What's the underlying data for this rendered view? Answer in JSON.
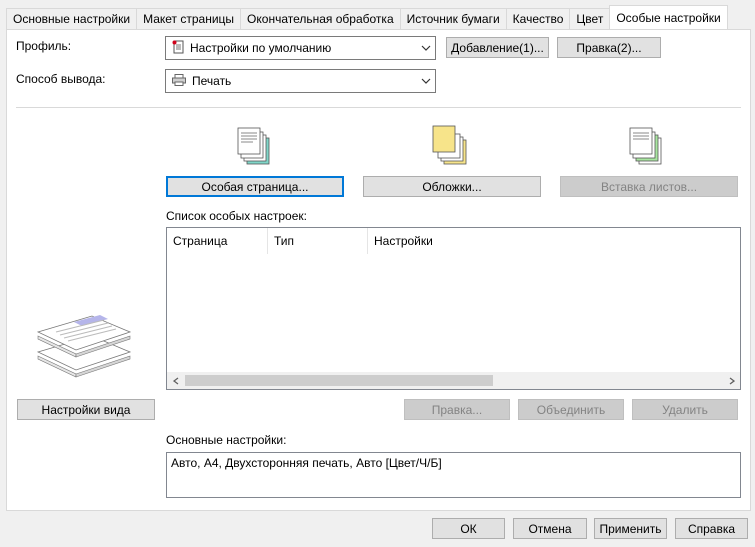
{
  "tabs": [
    {
      "label": "Основные настройки"
    },
    {
      "label": "Макет страницы"
    },
    {
      "label": "Окончательная обработка"
    },
    {
      "label": "Источник бумаги"
    },
    {
      "label": "Качество"
    },
    {
      "label": "Цвет"
    },
    {
      "label": "Особые настройки",
      "active": true
    }
  ],
  "profile": {
    "label": "Профиль:",
    "value": "Настройки по умолчанию",
    "add_button": "Добавление(1)...",
    "edit_button": "Правка(2)..."
  },
  "output": {
    "label": "Способ вывода:",
    "value": "Печать"
  },
  "special_buttons": {
    "special_page": "Особая страница...",
    "covers": "Обложки...",
    "insert_sheets": "Вставка листов..."
  },
  "list": {
    "label": "Список особых настроек:",
    "columns": [
      "Страница",
      "Тип",
      "Настройки"
    ]
  },
  "list_buttons": {
    "edit": "Правка...",
    "merge": "Объединить",
    "delete": "Удалить"
  },
  "view_settings_button": "Настройки вида",
  "summary": {
    "label": "Основные настройки:",
    "text": "Авто, А4, Двухсторонняя печать, Авто [Цвет/Ч/Б]"
  },
  "footer": {
    "ok": "ОК",
    "cancel": "Отмена",
    "apply": "Применить",
    "help": "Справка"
  }
}
